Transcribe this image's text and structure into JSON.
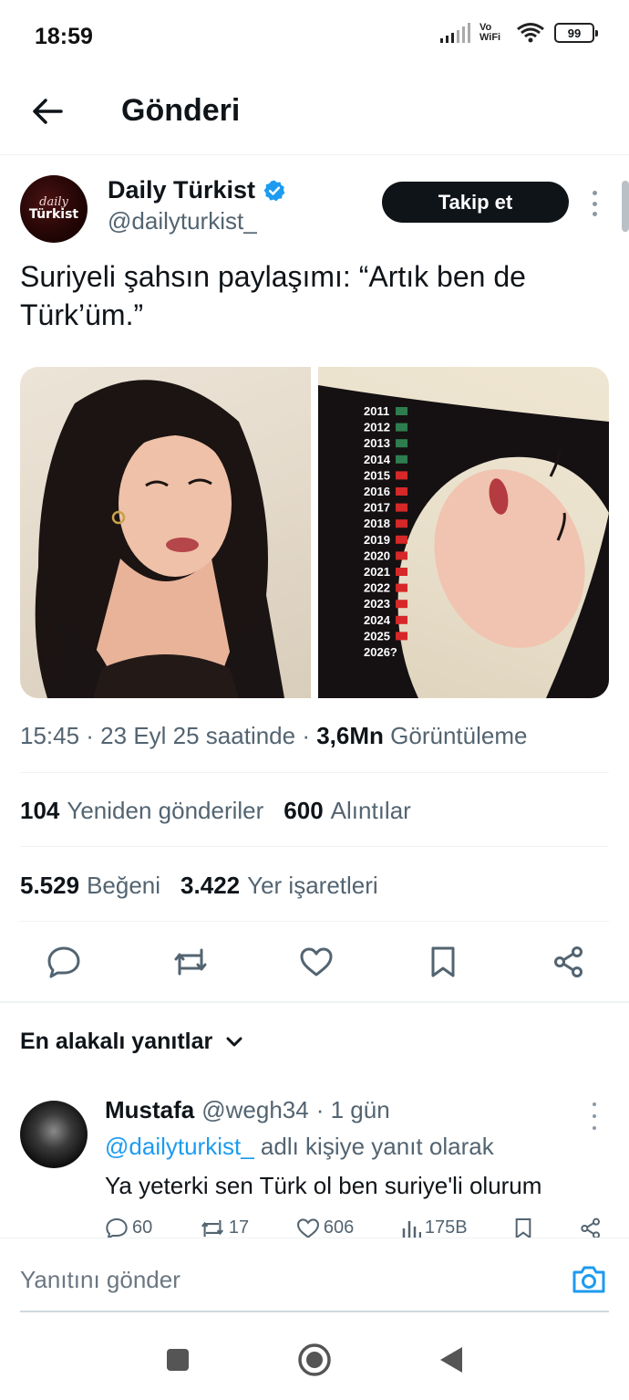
{
  "status_bar": {
    "time": "18:59",
    "network": "Vo WiFi",
    "battery": "99"
  },
  "header": {
    "title": "Gönderi"
  },
  "tweet": {
    "author_name": "Daily Türkist",
    "author_handle": "@dailyturkist_",
    "avatar_text_1": "daily",
    "avatar_text_2": "Türkist",
    "follow_label": "Takip et",
    "text": "Suriyeli şahsın paylaşımı: “Artık ben de Türk’üm.”",
    "image_2_years": [
      "2011",
      "2012",
      "2013",
      "2014",
      "2015",
      "2016",
      "2017",
      "2018",
      "2019",
      "2020",
      "2021",
      "2022",
      "2023",
      "2024",
      "2025",
      "2026?"
    ],
    "time": "15:45 · 23 Eyl 25 saatinde ·",
    "views": "3,6Mn",
    "views_label": "Görüntüleme",
    "reposts": "104",
    "reposts_label": "Yeniden gönderiler",
    "quotes": "600",
    "quotes_label": "Alıntılar",
    "likes": "5.529",
    "likes_label": "Beğeni",
    "bookmarks": "3.422",
    "bookmarks_label": "Yer işaretleri"
  },
  "replies": {
    "sort_label": "En alakalı yanıtlar",
    "items": [
      {
        "name": "Mustafa",
        "handle": "@wegh34",
        "time": "· 1 gün",
        "reply_to_mention": "@dailyturkist_",
        "reply_to_suffix": "adlı kişiye yanıt olarak",
        "text": "Ya yeterki sen Türk ol ben suriye'li olurum",
        "replies": "60",
        "reposts": "17",
        "likes": "606",
        "views": "175B"
      }
    ]
  },
  "compose": {
    "placeholder": "Yanıtını gönder"
  },
  "colors": {
    "accent": "#1d9bf0",
    "text": "#0f1419",
    "muted": "#536471",
    "button": "#0f1419"
  },
  "icons": [
    "back-arrow-icon",
    "verified-badge-icon",
    "more-icon",
    "reply-icon",
    "repost-icon",
    "like-icon",
    "bookmark-icon",
    "share-icon",
    "chevron-down-icon",
    "camera-icon",
    "nav-recents-icon",
    "nav-home-icon",
    "nav-back-icon"
  ]
}
